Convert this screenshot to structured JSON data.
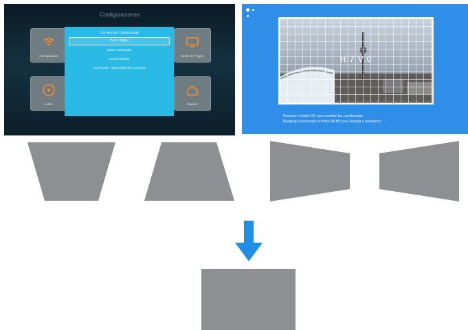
{
  "settings_screen": {
    "title": "Configuraciones",
    "tiles": {
      "config": "Configuración",
      "projector": "Modo de Proyec",
      "audio": "Audio",
      "more": "Mejorar"
    },
    "dialog": {
      "title": "Corrección Trapezoidal",
      "items": [
        "Zoom Digital",
        "Zoom Horizontal",
        "Zoom vertical",
        "Corrección Trapezoidal de 4 puntos"
      ]
    }
  },
  "grid_screen": {
    "photo_label": "H:7 V:0",
    "instruction_line1": "Presione el botón OK para cambiar las coordenadas",
    "instruction_line2": "Mantenga presionado el botón MENÚ para corregir y restablecer"
  },
  "colors": {
    "dialog_blue": "#2bb9e6",
    "screen_blue": "#2f8ee8",
    "shape_gray": "#8e8f93",
    "arrow_blue": "#1f8fe6"
  }
}
